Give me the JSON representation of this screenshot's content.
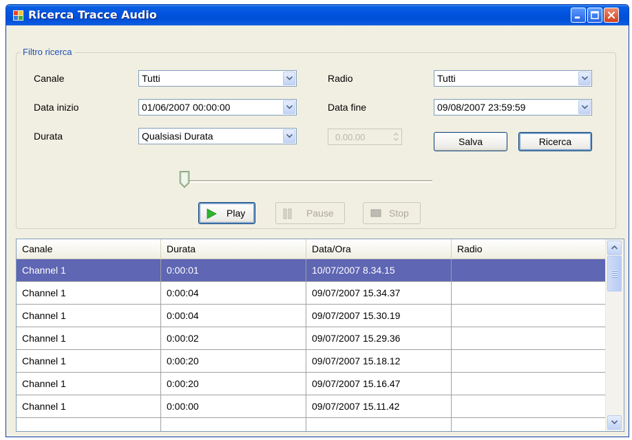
{
  "window": {
    "title": "Ricerca Tracce Audio"
  },
  "filter": {
    "group_label": "Filtro ricerca",
    "canale_label": "Canale",
    "canale_value": "Tutti",
    "radio_label": "Radio",
    "radio_value": "Tutti",
    "data_inizio_label": "Data inizio",
    "data_inizio_value": "01/06/2007  00:00:00",
    "data_fine_label": "Data fine",
    "data_fine_value": "09/08/2007  23:59:59",
    "durata_label": "Durata",
    "durata_value": "Qualsiasi Durata",
    "durata_spinner_value": "0.00.00",
    "salva_label": "Salva",
    "ricerca_label": "Ricerca"
  },
  "player": {
    "position": 0,
    "play_label": "Play",
    "pause_label": "Pause",
    "stop_label": "Stop"
  },
  "table": {
    "columns": [
      "Canale",
      "Durata",
      "Data/Ora",
      "Radio"
    ],
    "rows": [
      [
        "Channel 1",
        "0:00:01",
        "10/07/2007 8.34.15",
        ""
      ],
      [
        "Channel 1",
        "0:00:04",
        "09/07/2007 15.34.37",
        ""
      ],
      [
        "Channel 1",
        "0:00:04",
        "09/07/2007 15.30.19",
        ""
      ],
      [
        "Channel 1",
        "0:00:02",
        "09/07/2007 15.29.36",
        ""
      ],
      [
        "Channel 1",
        "0:00:20",
        "09/07/2007 15.18.12",
        ""
      ],
      [
        "Channel 1",
        "0:00:20",
        "09/07/2007 15.16.47",
        ""
      ],
      [
        "Channel 1",
        "0:00:00",
        "09/07/2007 15.11.42",
        ""
      ]
    ]
  },
  "colors": {
    "title_bar": "#0053e0",
    "selected_row": "#5f66b3",
    "group_label": "#1c4fb6",
    "window_bg": "#f1efe2"
  }
}
